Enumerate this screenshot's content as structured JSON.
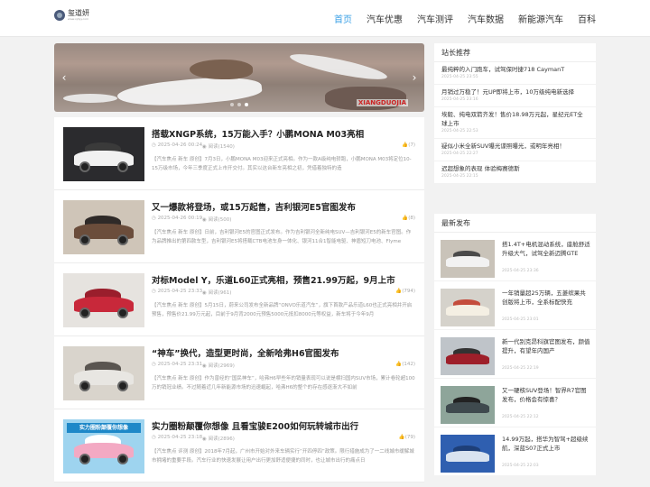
{
  "site": {
    "title": "玺道妍",
    "subtitle": "www.xjdyy.com"
  },
  "nav": [
    "首页",
    "汽车优惠",
    "汽车测评",
    "汽车数据",
    "新能源汽车",
    "百科"
  ],
  "banner": {
    "watermark": "XIANGDUOJIA"
  },
  "articles": [
    {
      "title": "搭载XNGP系统，15万能入手？小鹏MONA M03亮相",
      "time": "2025-04-26 00:24",
      "views": "阅读(1540)",
      "likes": "(7)",
      "excerpt": "【汽车焦点 新车 原创】7月3日，小鹏MONA M03迎来正式亮相。作为一款A级纯电轿跑，小鹏MONA M03将定位10-15万级市场，今年三季度正式上市开交付。其实以这台新车亮相之初，凭借着独特的造",
      "car": {
        "bg": "#2b2b2e",
        "body": "#f1f1f1",
        "roof": "#3a3a3a"
      }
    },
    {
      "title": "又一爆款将登场，或15万起售，吉利银河E5官图发布",
      "time": "2025-04-26 00:19",
      "views": "阅读(500)",
      "likes": "(8)",
      "excerpt": "【汽车焦点 新车 原创】日前，吉利银河E5的官图正式发布。作为吉利银河全新纯电SUV—吉利银河E5的新车官图。作为品牌推出的第四款车型，吉利银河E5将搭载CTB电池车身一体化、银河11合1智能电驱、神盾短刀电池、Flyme",
      "car": {
        "bg": "#cfc5b8",
        "body": "#6b4d3b",
        "roof": "#2f2a28"
      }
    },
    {
      "title": "对标Model Y，乐道L60正式亮相，预售21.99万起，9月上市",
      "time": "2025-04-25 23:33",
      "views": "阅读(961)",
      "likes": "(794)",
      "excerpt": "【汽车焦点 新车 原创】5月15日，蔚来公司发布全新品牌“ONVO乐道汽车”，旗下首款产品乐道L60也正式亮相并开启预售，预售价21.99万元起，目前于9月背2000元预售5000元抵扣8000元等权益，新车将于今年9月",
      "car": {
        "bg": "#e6e3df",
        "body": "#c8283a",
        "roof": "#9a1e2c"
      }
    },
    {
      "title": "“神车”换代，造型更时尚，全新哈弗H6官图发布",
      "time": "2025-04-25 23:31",
      "views": "阅读(2969)",
      "likes": "(142)",
      "excerpt": "【汽车焦点 新车 原创】作为曾经的“国民神车”，哈弗H6早些年的销量表现可以说是横扫国内SUV市场，累计卷轮超100万的销冠业绩。不过随着近几年新能源市场的迅速崛起，哈弗H6的整个的存在感逐渐大不如前",
      "car": {
        "bg": "#d9d4cc",
        "body": "#e8e6e2",
        "roof": "#5a5550"
      }
    },
    {
      "title": "实力圈粉颠覆你想像 且看宝骏E200如何玩转城市出行",
      "time": "2025-04-25 23:18",
      "views": "阅读(2896)",
      "likes": "(79)",
      "excerpt": "【汽车焦点 评测 原创】2018年7月起，广州市开始对外来车辆实行“开四停四”政策。限行措施成为了一二线城市缓解城市拥堵的重要手段。汽车行业的快速发展让用户出行更加舒适便捷的同时，也让城市出行的痛点日",
      "car": {
        "bg": "#9ed4ef",
        "body": "#f3a9c3",
        "roof": "#ffffff"
      },
      "banner_text": "实力圈粉颠覆你想像"
    }
  ],
  "sidebar": {
    "recommend": {
      "heading": "站长推荐",
      "items": [
        {
          "title": "最纯粹的入门跑车，试驾保时捷718 CaymanT",
          "date": "2025-04-25 23:55"
        },
        {
          "title": "月销过万稳了！元UP即将上市，10万级纯电新选择",
          "date": "2025-04-25 23:16"
        },
        {
          "title": "埃毅、纯电双箭齐发！售价18.98万元起，星纪元ET全球上市",
          "date": "2025-04-25 22:53"
        },
        {
          "title": "疑似小米全新SUV曝光谍照曝光，或明年亮相！",
          "date": "2025-04-25 22:27"
        },
        {
          "title": "迟超想象的表现 体验梅赛德斯",
          "date": "2025-04-25 22:15"
        }
      ]
    },
    "latest": {
      "heading": "最新发布",
      "items": [
        {
          "title": "搭1.4T+电机混动系统，座舱舒适升级大气，试驾全新迈腾GTE",
          "date": "2025-04-25 23:36",
          "car": {
            "bg": "#c9c3b9",
            "body": "#f2f2f2",
            "roof": "#4a4a4a"
          }
        },
        {
          "title": "一年销量超25万辆，五菱缤果共创版将上市，全系标配快充",
          "date": "2025-04-25 23:01",
          "car": {
            "bg": "#d5d2cb",
            "body": "#f4efe3",
            "roof": "#c44c3c"
          }
        },
        {
          "title": "新一代别克昂科旗官图发布，颜值提升，有望年内国产",
          "date": "2025-04-25 22:19",
          "car": {
            "bg": "#bfc4c9",
            "body": "#9e1f2a",
            "roof": "#333333"
          }
        },
        {
          "title": "又一硬核SUV登场！智界R7官图发布，价格会有惊喜？",
          "date": "2025-04-25 22:12",
          "car": {
            "bg": "#8ea59a",
            "body": "#3f4a4e",
            "roof": "#222222"
          }
        },
        {
          "title": "14.99万起，搭华为智驾+超级续航，深蓝S07正式上市",
          "date": "2025-04-25 22:03",
          "car": {
            "bg": "#2f5fb0",
            "body": "#d9e3f0",
            "roof": "#1e3f78"
          }
        }
      ]
    }
  },
  "colors": {
    "accent": "#3aa0e6"
  },
  "icons": [
    "clock-icon",
    "eye-icon",
    "thumb-up-icon",
    "chevron-left-icon",
    "chevron-right-icon"
  ]
}
